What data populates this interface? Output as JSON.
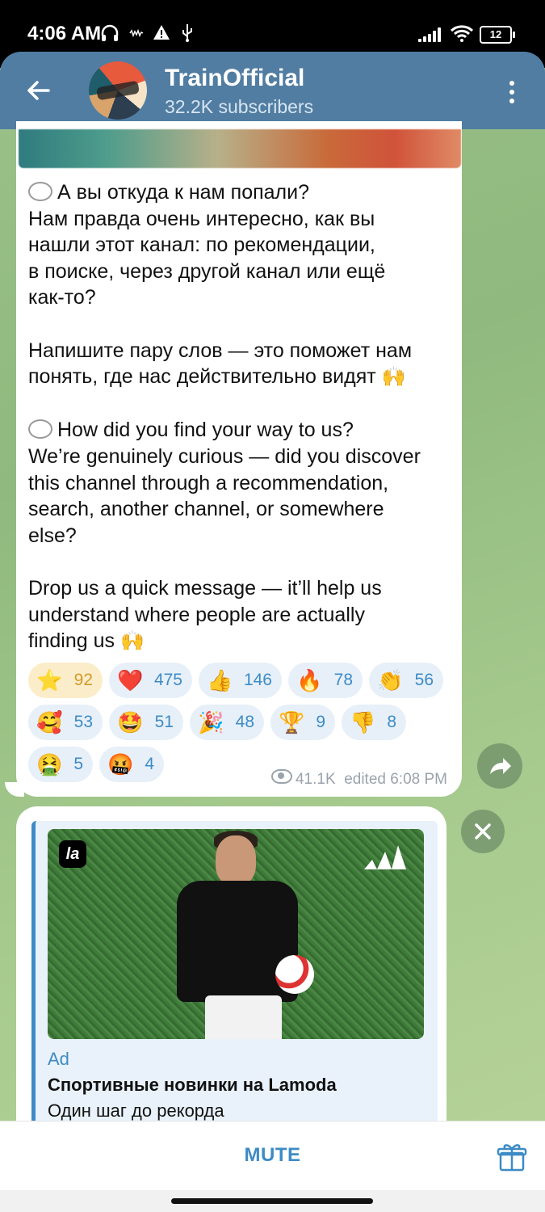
{
  "status_bar": {
    "time": "4:06 AM",
    "battery": "12"
  },
  "header": {
    "channel_name": "TrainOfficial",
    "subscribers": "32.2K subscribers",
    "back_icon": "arrow-left-icon",
    "menu_icon": "more-vertical-icon"
  },
  "post": {
    "ru_question": "А вы откуда к нам попали?",
    "ru_body": "Нам правда очень интересно, как вы\nнашли этот канал: по рекомендации,\nв поиске, через другой канал или ещё\nкак-то?",
    "ru_cta": "Напишите пару слов — это поможет нам\nпонять, где нас действительно видят",
    "en_question": "How did you find your way to us?",
    "en_body": "We’re genuinely curious — did you discover\nthis channel through a recommendation,\nsearch, another channel, or somewhere\nelse?",
    "en_cta": "Drop us a quick message — it’ll help us\nunderstand where people are actually\nfinding us",
    "reactions": [
      {
        "emoji": "⭐",
        "count": "92"
      },
      {
        "emoji": "❤️",
        "count": "475"
      },
      {
        "emoji": "👍",
        "count": "146"
      },
      {
        "emoji": "🔥",
        "count": "78"
      },
      {
        "emoji": "👏",
        "count": "56"
      },
      {
        "emoji": "🥰",
        "count": "53"
      },
      {
        "emoji": "🤩",
        "count": "51"
      },
      {
        "emoji": "🎉",
        "count": "48"
      },
      {
        "emoji": "🏆",
        "count": "9"
      },
      {
        "emoji": "👎",
        "count": "8"
      },
      {
        "emoji": "🤮",
        "count": "5"
      },
      {
        "emoji": "🤬",
        "count": "4"
      }
    ],
    "views": "41.1K",
    "edited": "edited 6:08 PM"
  },
  "ad": {
    "label": "Ad",
    "title": "Спортивные новинки на Lamoda",
    "text": "Один шаг до рекорда",
    "brand_logo": "la"
  },
  "bottom_bar": {
    "mute_label": "MUTE",
    "gift_icon": "gift-icon"
  },
  "colors": {
    "header": "#517da2",
    "accent": "#3d8bc6",
    "selected_reaction": "#fbedc9"
  }
}
